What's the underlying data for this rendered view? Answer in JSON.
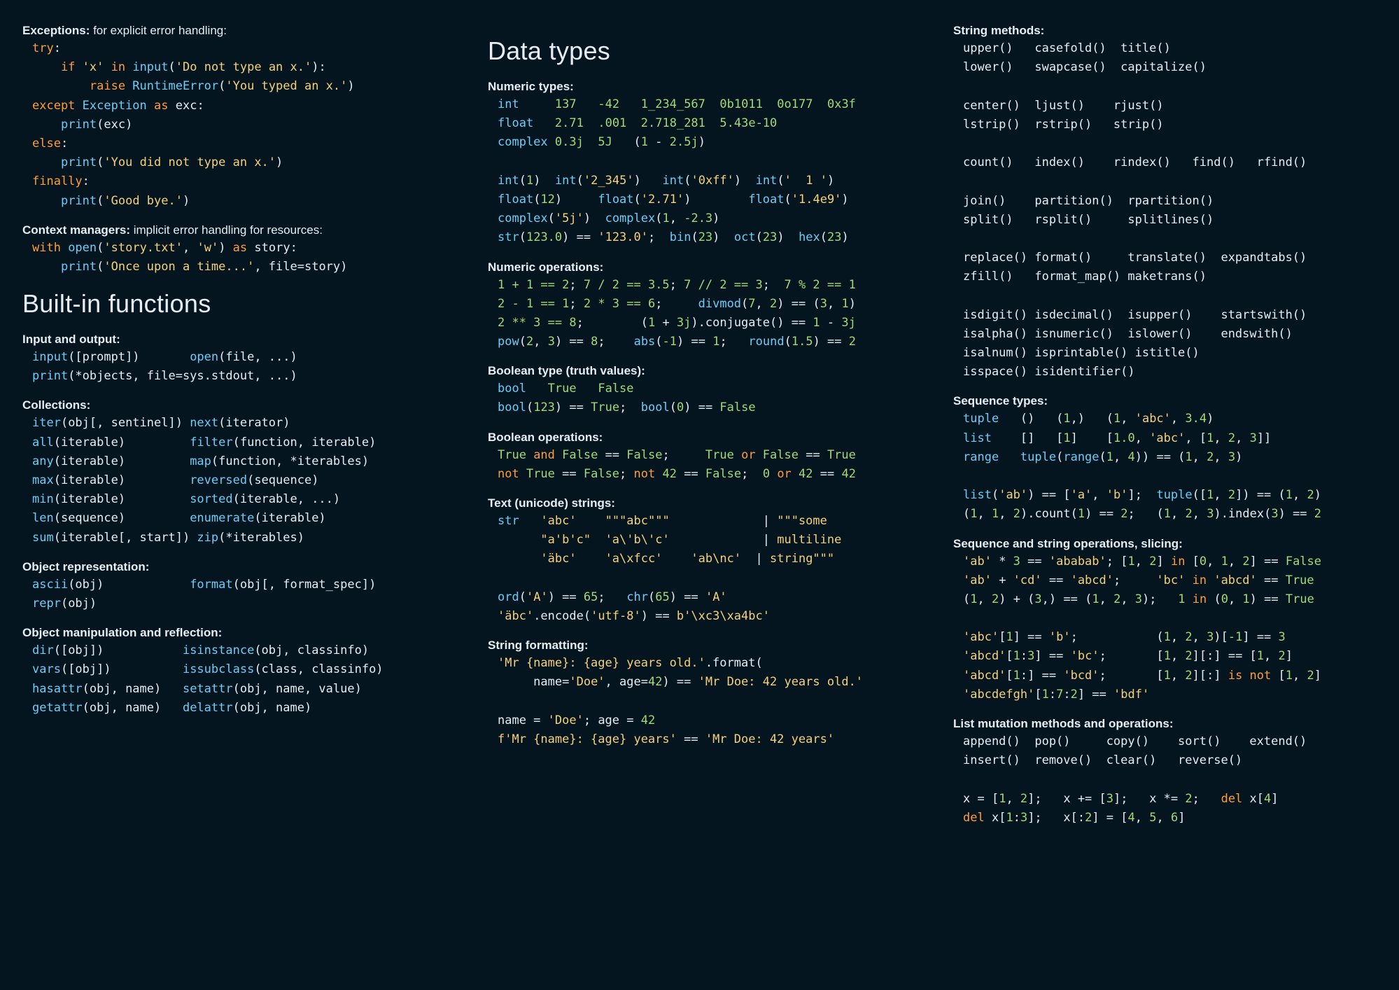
{
  "col1": {
    "exceptions_title_b": "Exceptions:",
    "exceptions_title_rest": " for explicit error handling:",
    "l1a": "try",
    "l1b": ":",
    "l2a": "    if ",
    "l2b": "'x'",
    "l2c": " in ",
    "l2d": "input",
    "l2e": "(",
    "l2f": "'Do not type an x.'",
    "l2g": "):",
    "l3a": "        raise ",
    "l3b": "RuntimeError",
    "l3c": "(",
    "l3d": "'You typed an x.'",
    "l3e": ")",
    "l4a": "except ",
    "l4b": "Exception",
    "l4c": " as ",
    "l4d": "exc:",
    "l5a": "    ",
    "l5b": "print",
    "l5c": "(exc)",
    "l6a": "else",
    "l6b": ":",
    "l7a": "    ",
    "l7b": "print",
    "l7c": "(",
    "l7d": "'You did not type an x.'",
    "l7e": ")",
    "l8a": "finally",
    "l8b": ":",
    "l9a": "    ",
    "l9b": "print",
    "l9c": "(",
    "l9d": "'Good bye.'",
    "l9e": ")",
    "ctx_title_b": "Context managers:",
    "ctx_title_rest": " implicit error handling for resources:",
    "c1a": "with ",
    "c1b": "open",
    "c1c": "(",
    "c1d": "'story.txt'",
    "c1e": ", ",
    "c1f": "'w'",
    "c1g": ") ",
    "c1h": "as ",
    "c1i": "story:",
    "c2a": "    ",
    "c2b": "print",
    "c2c": "(",
    "c2d": "'Once upon a time...'",
    "c2e": ", file=story)",
    "h_builtins": "Built-in functions",
    "io_title": "Input and output:",
    "io1a": "input",
    "io1b": "([prompt])       ",
    "io1c": "open",
    "io1d": "(file, ...)",
    "io2a": "print",
    "io2b": "(*objects, file=sys.stdout, ...)",
    "coll_title": "Collections:",
    "cl1a": "iter",
    "cl1b": "(obj[, sentinel]) ",
    "cl1c": "next",
    "cl1d": "(iterator)",
    "cl2a": "all",
    "cl2b": "(iterable)         ",
    "cl2c": "filter",
    "cl2d": "(function, iterable)",
    "cl3a": "any",
    "cl3b": "(iterable)         ",
    "cl3c": "map",
    "cl3d": "(function, *iterables)",
    "cl4a": "max",
    "cl4b": "(iterable)         ",
    "cl4c": "reversed",
    "cl4d": "(sequence)",
    "cl5a": "min",
    "cl5b": "(iterable)         ",
    "cl5c": "sorted",
    "cl5d": "(iterable, ...)",
    "cl6a": "len",
    "cl6b": "(sequence)         ",
    "cl6c": "enumerate",
    "cl6d": "(iterable)",
    "cl7a": "sum",
    "cl7b": "(iterable[, start]) ",
    "cl7c": "zip",
    "cl7d": "(*iterables)",
    "repr_title": "Object representation:",
    "r1a": "ascii",
    "r1b": "(obj)            ",
    "r1c": "format",
    "r1d": "(obj[, format_spec])",
    "r2a": "repr",
    "r2b": "(obj)",
    "refl_title": "Object manipulation and reflection:",
    "rf1a": "dir",
    "rf1b": "([obj])           ",
    "rf1c": "isinstance",
    "rf1d": "(obj, classinfo)",
    "rf2a": "vars",
    "rf2b": "([obj])          ",
    "rf2c": "issubclass",
    "rf2d": "(class, classinfo)",
    "rf3a": "hasattr",
    "rf3b": "(obj, name)   ",
    "rf3c": "setattr",
    "rf3d": "(obj, name, value)",
    "rf4a": "getattr",
    "rf4b": "(obj, name)   ",
    "rf4c": "delattr",
    "rf4d": "(obj, name)"
  },
  "col2": {
    "h_datatypes": "Data types",
    "num_title": "Numeric types:",
    "n1a": "int",
    "n1b": "     ",
    "n1c": "137",
    "n1d": "   ",
    "n1e": "-42",
    "n1f": "   ",
    "n1g": "1_234_567",
    "n1h": "  ",
    "n1i": "0b1011",
    "n1j": "  ",
    "n1k": "0o177",
    "n1l": "  ",
    "n1m": "0x3f",
    "n2a": "float",
    "n2b": "   ",
    "n2c": "2.71",
    "n2d": "  ",
    "n2e": ".001",
    "n2f": "  ",
    "n2g": "2.718_281",
    "n2h": "  ",
    "n2i": "5.43e-10",
    "n3a": "complex",
    "n3b": " ",
    "n3c": "0.3j",
    "n3d": "  ",
    "n3e": "5J",
    "n3f": "   (",
    "n3g": "1",
    "n3h": " - ",
    "n3i": "2.5j",
    "n3j": ")",
    "n4a": "int",
    "n4b": "(",
    "n4c": "1",
    "n4d": ")  ",
    "n4e": "int",
    "n4f": "(",
    "n4g": "'2_345'",
    "n4h": ")   ",
    "n4i": "int",
    "n4j": "(",
    "n4k": "'0xff'",
    "n4l": ")  ",
    "n4m": "int",
    "n4n": "(",
    "n4o": "'  1 '",
    "n4p": ")",
    "n5a": "float",
    "n5b": "(",
    "n5c": "12",
    "n5d": ")     ",
    "n5e": "float",
    "n5f": "(",
    "n5g": "'2.71'",
    "n5h": ")        ",
    "n5i": "float",
    "n5j": "(",
    "n5k": "'1.4e9'",
    "n5l": ")",
    "n6a": "complex",
    "n6b": "(",
    "n6c": "'5j'",
    "n6d": ")  ",
    "n6e": "complex",
    "n6f": "(",
    "n6g": "1",
    "n6h": ", ",
    "n6i": "-2.3",
    "n6j": ")",
    "n7a": "str",
    "n7b": "(",
    "n7c": "123.0",
    "n7d": ") == ",
    "n7e": "'123.0'",
    "n7f": ";  ",
    "n7g": "bin",
    "n7h": "(",
    "n7i": "23",
    "n7j": ")  ",
    "n7k": "oct",
    "n7l": "(",
    "n7m": "23",
    "n7n": ")  ",
    "n7o": "hex",
    "n7p": "(",
    "n7q": "23",
    "n7r": ")",
    "op_title": "Numeric operations:",
    "o1": "1 + 1 == 2",
    "o1b": "; ",
    "o1c": "7 / 2 == 3.5",
    "o1d": "; ",
    "o1e": "7 // 2 == 3",
    "o1f": ";  ",
    "o1g": "7 % 2 == 1",
    "o2": "2 - 1 == 1",
    "o2b": "; ",
    "o2c": "2 * 3 == 6",
    "o2d": ";     ",
    "o2e": "divmod",
    "o2f": "(",
    "o2g": "7",
    "o2h": ", ",
    "o2i": "2",
    "o2j": ") == (",
    "o2k": "3",
    "o2l": ", ",
    "o2m": "1",
    "o2n": ")",
    "o3": "2 ** 3 == 8",
    "o3b": ";        (",
    "o3c": "1",
    "o3d": " + ",
    "o3e": "3j",
    "o3f": ").conjugate() == ",
    "o3g": "1",
    "o3h": " - ",
    "o3i": "3j",
    "o4a": "pow",
    "o4b": "(",
    "o4c": "2",
    "o4d": ", ",
    "o4e": "3",
    "o4f": ") == ",
    "o4g": "8",
    "o4h": ";    ",
    "o4i": "abs",
    "o4j": "(",
    "o4k": "-1",
    "o4l": ") == ",
    "o4m": "1",
    "o4n": ";   ",
    "o4o": "round",
    "o4p": "(",
    "o4q": "1.5",
    "o4r": ") == ",
    "o4s": "2",
    "bool_title": "Boolean type (truth values):",
    "b1a": "bool",
    "b1b": "   ",
    "b1c": "True",
    "b1d": "   ",
    "b1e": "False",
    "b2a": "bool",
    "b2b": "(",
    "b2c": "123",
    "b2d": ") == ",
    "b2e": "True",
    "b2f": ";  ",
    "b2g": "bool",
    "b2h": "(",
    "b2i": "0",
    "b2j": ") == ",
    "b2k": "False",
    "bop_title": "Boolean operations:",
    "bo1a": "True",
    "bo1b": " and ",
    "bo1c": "False",
    "bo1d": " == ",
    "bo1e": "False",
    "bo1f": ";     ",
    "bo1g": "True",
    "bo1h": " or ",
    "bo1i": "False",
    "bo1j": " == ",
    "bo1k": "True",
    "bo2a": "not ",
    "bo2b": "True",
    "bo2c": " == ",
    "bo2d": "False",
    "bo2e": "; ",
    "bo2f": "not ",
    "bo2g": "42",
    "bo2h": " == ",
    "bo2i": "False",
    "bo2j": ";  ",
    "bo2k": "0",
    "bo2l": " or ",
    "bo2m": "42",
    "bo2n": " == ",
    "bo2o": "42",
    "txt_title": "Text (unicode) strings:",
    "t1a": "str",
    "t1b": "   ",
    "t1c": "'abc'",
    "t1d": "    ",
    "t1e": "\"\"\"abc\"\"\"",
    "t1f": "             | ",
    "t1g": "\"\"\"some",
    "t2a": "      ",
    "t2b": "\"a'b'c\"",
    "t2c": "  ",
    "t2d": "'a\\'b\\'c'",
    "t2e": "             | ",
    "t2f": "multiline",
    "t3a": "      ",
    "t3b": "'äbc'",
    "t3c": "    ",
    "t3d": "'a\\xfcc'",
    "t3e": "    ",
    "t3f": "'ab\\nc'",
    "t3g": "  | ",
    "t3h": "string\"\"\"",
    "t4a": "ord",
    "t4b": "(",
    "t4c": "'A'",
    "t4d": ") == ",
    "t4e": "65",
    "t4f": ";   ",
    "t4g": "chr",
    "t4h": "(",
    "t4i": "65",
    "t4j": ") == ",
    "t4k": "'A'",
    "t5a": "'äbc'",
    "t5b": ".encode(",
    "t5c": "'utf-8'",
    "t5d": ") == ",
    "t5e": "b'\\xc3\\xa4bc'",
    "fmt_title": "String formatting:",
    "f1a": "'Mr {name}: {age} years old.'",
    "f1b": ".format(",
    "f2a": "     name=",
    "f2b": "'Doe'",
    "f2c": ", age=",
    "f2d": "42",
    "f2e": ") == ",
    "f2f": "'Mr Doe: 42 years old.'",
    "f3a": "name = ",
    "f3b": "'Doe'",
    "f3c": "; age = ",
    "f3d": "42",
    "f4a": "f'Mr {name}: {age} years'",
    "f4b": " == ",
    "f4c": "'Mr Doe: 42 years'"
  },
  "col3": {
    "sm_title": "String methods:",
    "sm1": "upper()   casefold()  title()",
    "sm2": "lower()   swapcase()  capitalize()",
    "sm3": "center()  ljust()    rjust()",
    "sm4": "lstrip()  rstrip()   strip()",
    "sm5": "count()   index()    rindex()   find()   rfind()",
    "sm6": "join()    partition()  rpartition()",
    "sm7": "split()   rsplit()     splitlines()",
    "sm8": "replace() format()     translate()  expandtabs()",
    "sm9": "zfill()   format_map() maketrans()",
    "sm10": "isdigit() isdecimal()  isupper()    startswith()",
    "sm11": "isalpha() isnumeric()  islower()    endswith()",
    "sm12": "isalnum() isprintable() istitle()",
    "sm13": "isspace() isidentifier()",
    "seq_title": "Sequence types:",
    "sq1a": "tuple",
    "sq1b": "   ()   (",
    "sq1c": "1",
    "sq1d": ",)   (",
    "sq1e": "1",
    "sq1f": ", ",
    "sq1g": "'abc'",
    "sq1h": ", ",
    "sq1i": "3.4",
    "sq1j": ")",
    "sq2a": "list",
    "sq2b": "    []   [",
    "sq2c": "1",
    "sq2d": "]    [",
    "sq2e": "1.0",
    "sq2f": ", ",
    "sq2g": "'abc'",
    "sq2h": ", [",
    "sq2i": "1",
    "sq2j": ", ",
    "sq2k": "2",
    "sq2l": ", ",
    "sq2m": "3",
    "sq2n": "]]",
    "sq3a": "range",
    "sq3b": "   ",
    "sq3c": "tuple",
    "sq3d": "(",
    "sq3e": "range",
    "sq3f": "(",
    "sq3g": "1",
    "sq3h": ", ",
    "sq3i": "4",
    "sq3j": ")) == (",
    "sq3k": "1",
    "sq3l": ", ",
    "sq3m": "2",
    "sq3n": ", ",
    "sq3o": "3",
    "sq3p": ")",
    "sq4a": "list",
    "sq4b": "(",
    "sq4c": "'ab'",
    "sq4d": ") == [",
    "sq4e": "'a'",
    "sq4f": ", ",
    "sq4g": "'b'",
    "sq4h": "];  ",
    "sq4i": "tuple",
    "sq4j": "([",
    "sq4k": "1",
    "sq4l": ", ",
    "sq4m": "2",
    "sq4n": "]) == (",
    "sq4o": "1",
    "sq4p": ", ",
    "sq4q": "2",
    "sq4r": ")",
    "sq5a": "(",
    "sq5b": "1",
    "sq5c": ", ",
    "sq5d": "1",
    "sq5e": ", ",
    "sq5f": "2",
    "sq5g": ").count(",
    "sq5h": "1",
    "sq5i": ") == ",
    "sq5j": "2",
    "sq5k": ";   (",
    "sq5l": "1",
    "sq5m": ", ",
    "sq5n": "2",
    "sq5o": ", ",
    "sq5p": "3",
    "sq5q": ").index(",
    "sq5r": "3",
    "sq5s": ") == ",
    "sq5t": "2",
    "so_title": "Sequence and string operations, slicing:",
    "so1a": "'ab'",
    "so1b": " * ",
    "so1c": "3",
    "so1d": " == ",
    "so1e": "'ababab'",
    "so1f": "; [",
    "so1g": "1",
    "so1h": ", ",
    "so1i": "2",
    "so1j": "] ",
    "so1k": "in ",
    "so1l": "[",
    "so1m": "0",
    "so1n": ", ",
    "so1o": "1",
    "so1p": ", ",
    "so1q": "2",
    "so1r": "] == ",
    "so1s": "False",
    "so2a": "'ab'",
    "so2b": " + ",
    "so2c": "'cd'",
    "so2d": " == ",
    "so2e": "'abcd'",
    "so2f": ";     ",
    "so2g": "'bc'",
    "so2h": " in ",
    "so2i": "'abcd'",
    "so2j": " == ",
    "so2k": "True",
    "so3a": "(",
    "so3b": "1",
    "so3c": ", ",
    "so3d": "2",
    "so3e": ") + (",
    "so3f": "3",
    "so3g": ",) == (",
    "so3h": "1",
    "so3i": ", ",
    "so3j": "2",
    "so3k": ", ",
    "so3l": "3",
    "so3m": ");   ",
    "so3n": "1",
    "so3o": " in ",
    "so3p": "(",
    "so3q": "0",
    "so3r": ", ",
    "so3s": "1",
    "so3t": ") == ",
    "so3u": "True",
    "so4a": "'abc'",
    "so4b": "[",
    "so4c": "1",
    "so4d": "] == ",
    "so4e": "'b'",
    "so4f": ";           (",
    "so4g": "1",
    "so4h": ", ",
    "so4i": "2",
    "so4j": ", ",
    "so4k": "3",
    "so4l": ")[",
    "so4m": "-1",
    "so4n": "] == ",
    "so4o": "3",
    "so5a": "'abcd'",
    "so5b": "[",
    "so5c": "1",
    "so5d": ":",
    "so5e": "3",
    "so5f": "] == ",
    "so5g": "'bc'",
    "so5h": ";       [",
    "so5i": "1",
    "so5j": ", ",
    "so5k": "2",
    "so5l": "][:] == [",
    "so5m": "1",
    "so5n": ", ",
    "so5o": "2",
    "so5p": "]",
    "so6a": "'abcd'",
    "so6b": "[",
    "so6c": "1",
    "so6d": ":] == ",
    "so6e": "'bcd'",
    "so6f": ";       [",
    "so6g": "1",
    "so6h": ", ",
    "so6i": "2",
    "so6j": "][:] ",
    "so6k": "is not ",
    "so6l": "[",
    "so6m": "1",
    "so6n": ", ",
    "so6o": "2",
    "so6p": "]",
    "so7a": "'abcdefgh'",
    "so7b": "[",
    "so7c": "1",
    "so7d": ":",
    "so7e": "7",
    "so7f": ":",
    "so7g": "2",
    "so7h": "] == ",
    "so7i": "'bdf'",
    "lm_title": "List mutation methods and operations:",
    "lm1": "append()  pop()     copy()    sort()    extend()",
    "lm2": "insert()  remove()  clear()   reverse()",
    "lm3a": "x = [",
    "lm3b": "1",
    "lm3c": ", ",
    "lm3d": "2",
    "lm3e": "];   x += [",
    "lm3f": "3",
    "lm3g": "];   x *= ",
    "lm3h": "2",
    "lm3i": ";   ",
    "lm3j": "del ",
    "lm3k": "x[",
    "lm3l": "4",
    "lm3m": "]",
    "lm4a": "del ",
    "lm4b": "x[",
    "lm4c": "1",
    "lm4d": ":",
    "lm4e": "3",
    "lm4f": "];   x[:",
    "lm4g": "2",
    "lm4h": "] = [",
    "lm4i": "4",
    "lm4j": ", ",
    "lm4k": "5",
    "lm4l": ", ",
    "lm4m": "6",
    "lm4n": "]"
  }
}
